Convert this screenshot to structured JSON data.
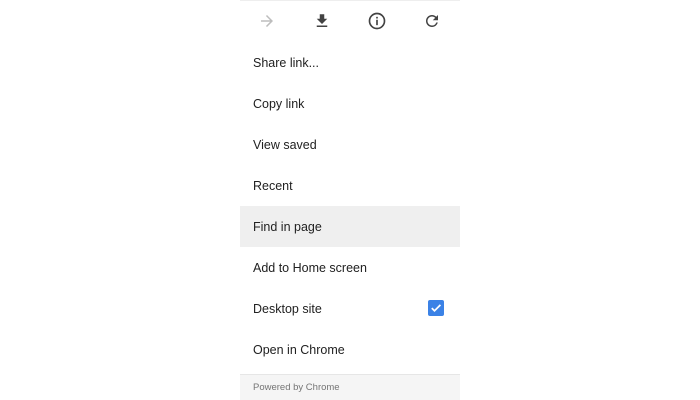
{
  "toolbar": {
    "icons": [
      {
        "name": "forward-icon",
        "enabled": false
      },
      {
        "name": "download-icon",
        "enabled": true
      },
      {
        "name": "info-icon",
        "enabled": true
      },
      {
        "name": "refresh-icon",
        "enabled": true
      }
    ]
  },
  "menu": {
    "items": [
      {
        "label": "Share link..."
      },
      {
        "label": "Copy link"
      },
      {
        "label": "View saved"
      },
      {
        "label": "Recent"
      },
      {
        "label": "Find in page",
        "highlighted": true
      },
      {
        "label": "Add to Home screen"
      },
      {
        "label": "Desktop site",
        "checked": true
      },
      {
        "label": "Open in Chrome"
      }
    ]
  },
  "footer": {
    "text": "Powered by Chrome"
  },
  "colors": {
    "checkbox": "#3b82e6",
    "highlight": "#efefef",
    "icon": "#424242",
    "icon_disabled": "#bdbdbd"
  }
}
